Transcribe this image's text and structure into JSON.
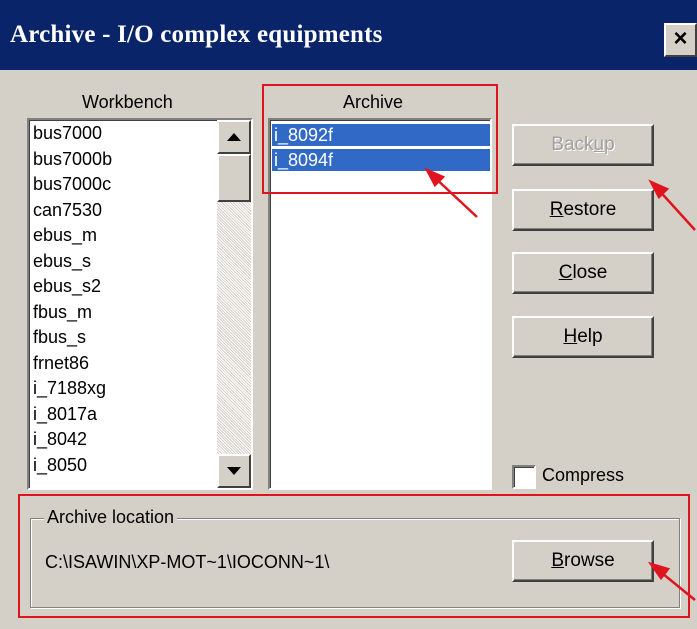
{
  "window": {
    "title": "Archive - I/O complex equipments",
    "close_glyph": "×"
  },
  "workbench": {
    "label": "Workbench",
    "items": [
      "bus7000",
      "bus7000b",
      "bus7000c",
      "can7530",
      "ebus_m",
      "ebus_s",
      "ebus_s2",
      "fbus_m",
      "fbus_s",
      "frnet86",
      "i_7188xg",
      "i_8017a",
      "i_8042",
      "i_8050"
    ]
  },
  "archive": {
    "label": "Archive",
    "items": [
      "i_8092f",
      "i_8094f"
    ],
    "selected": [
      "i_8092f",
      "i_8094f"
    ]
  },
  "buttons": {
    "backup": {
      "label": "Backup",
      "underline": "u",
      "enabled": false
    },
    "restore": {
      "label": "Restore",
      "underline": "R"
    },
    "close": {
      "label": "Close",
      "underline": "C"
    },
    "help": {
      "label": "Help",
      "underline": "H"
    },
    "browse": {
      "label": "Browse",
      "underline": "B"
    }
  },
  "compress": {
    "label": "Compress",
    "checked": false
  },
  "location": {
    "group_label": "Archive location",
    "path": "C:\\ISAWIN\\XP-MOT~1\\IOCONN~1\\"
  },
  "colors": {
    "title_bar": "#0a246a",
    "selection": "#3169c6",
    "annotation_red": "#e0141e",
    "dialog_face": "#d4d0c8"
  },
  "icons": {
    "scroll_up": "triangle-up",
    "scroll_down": "triangle-down"
  }
}
